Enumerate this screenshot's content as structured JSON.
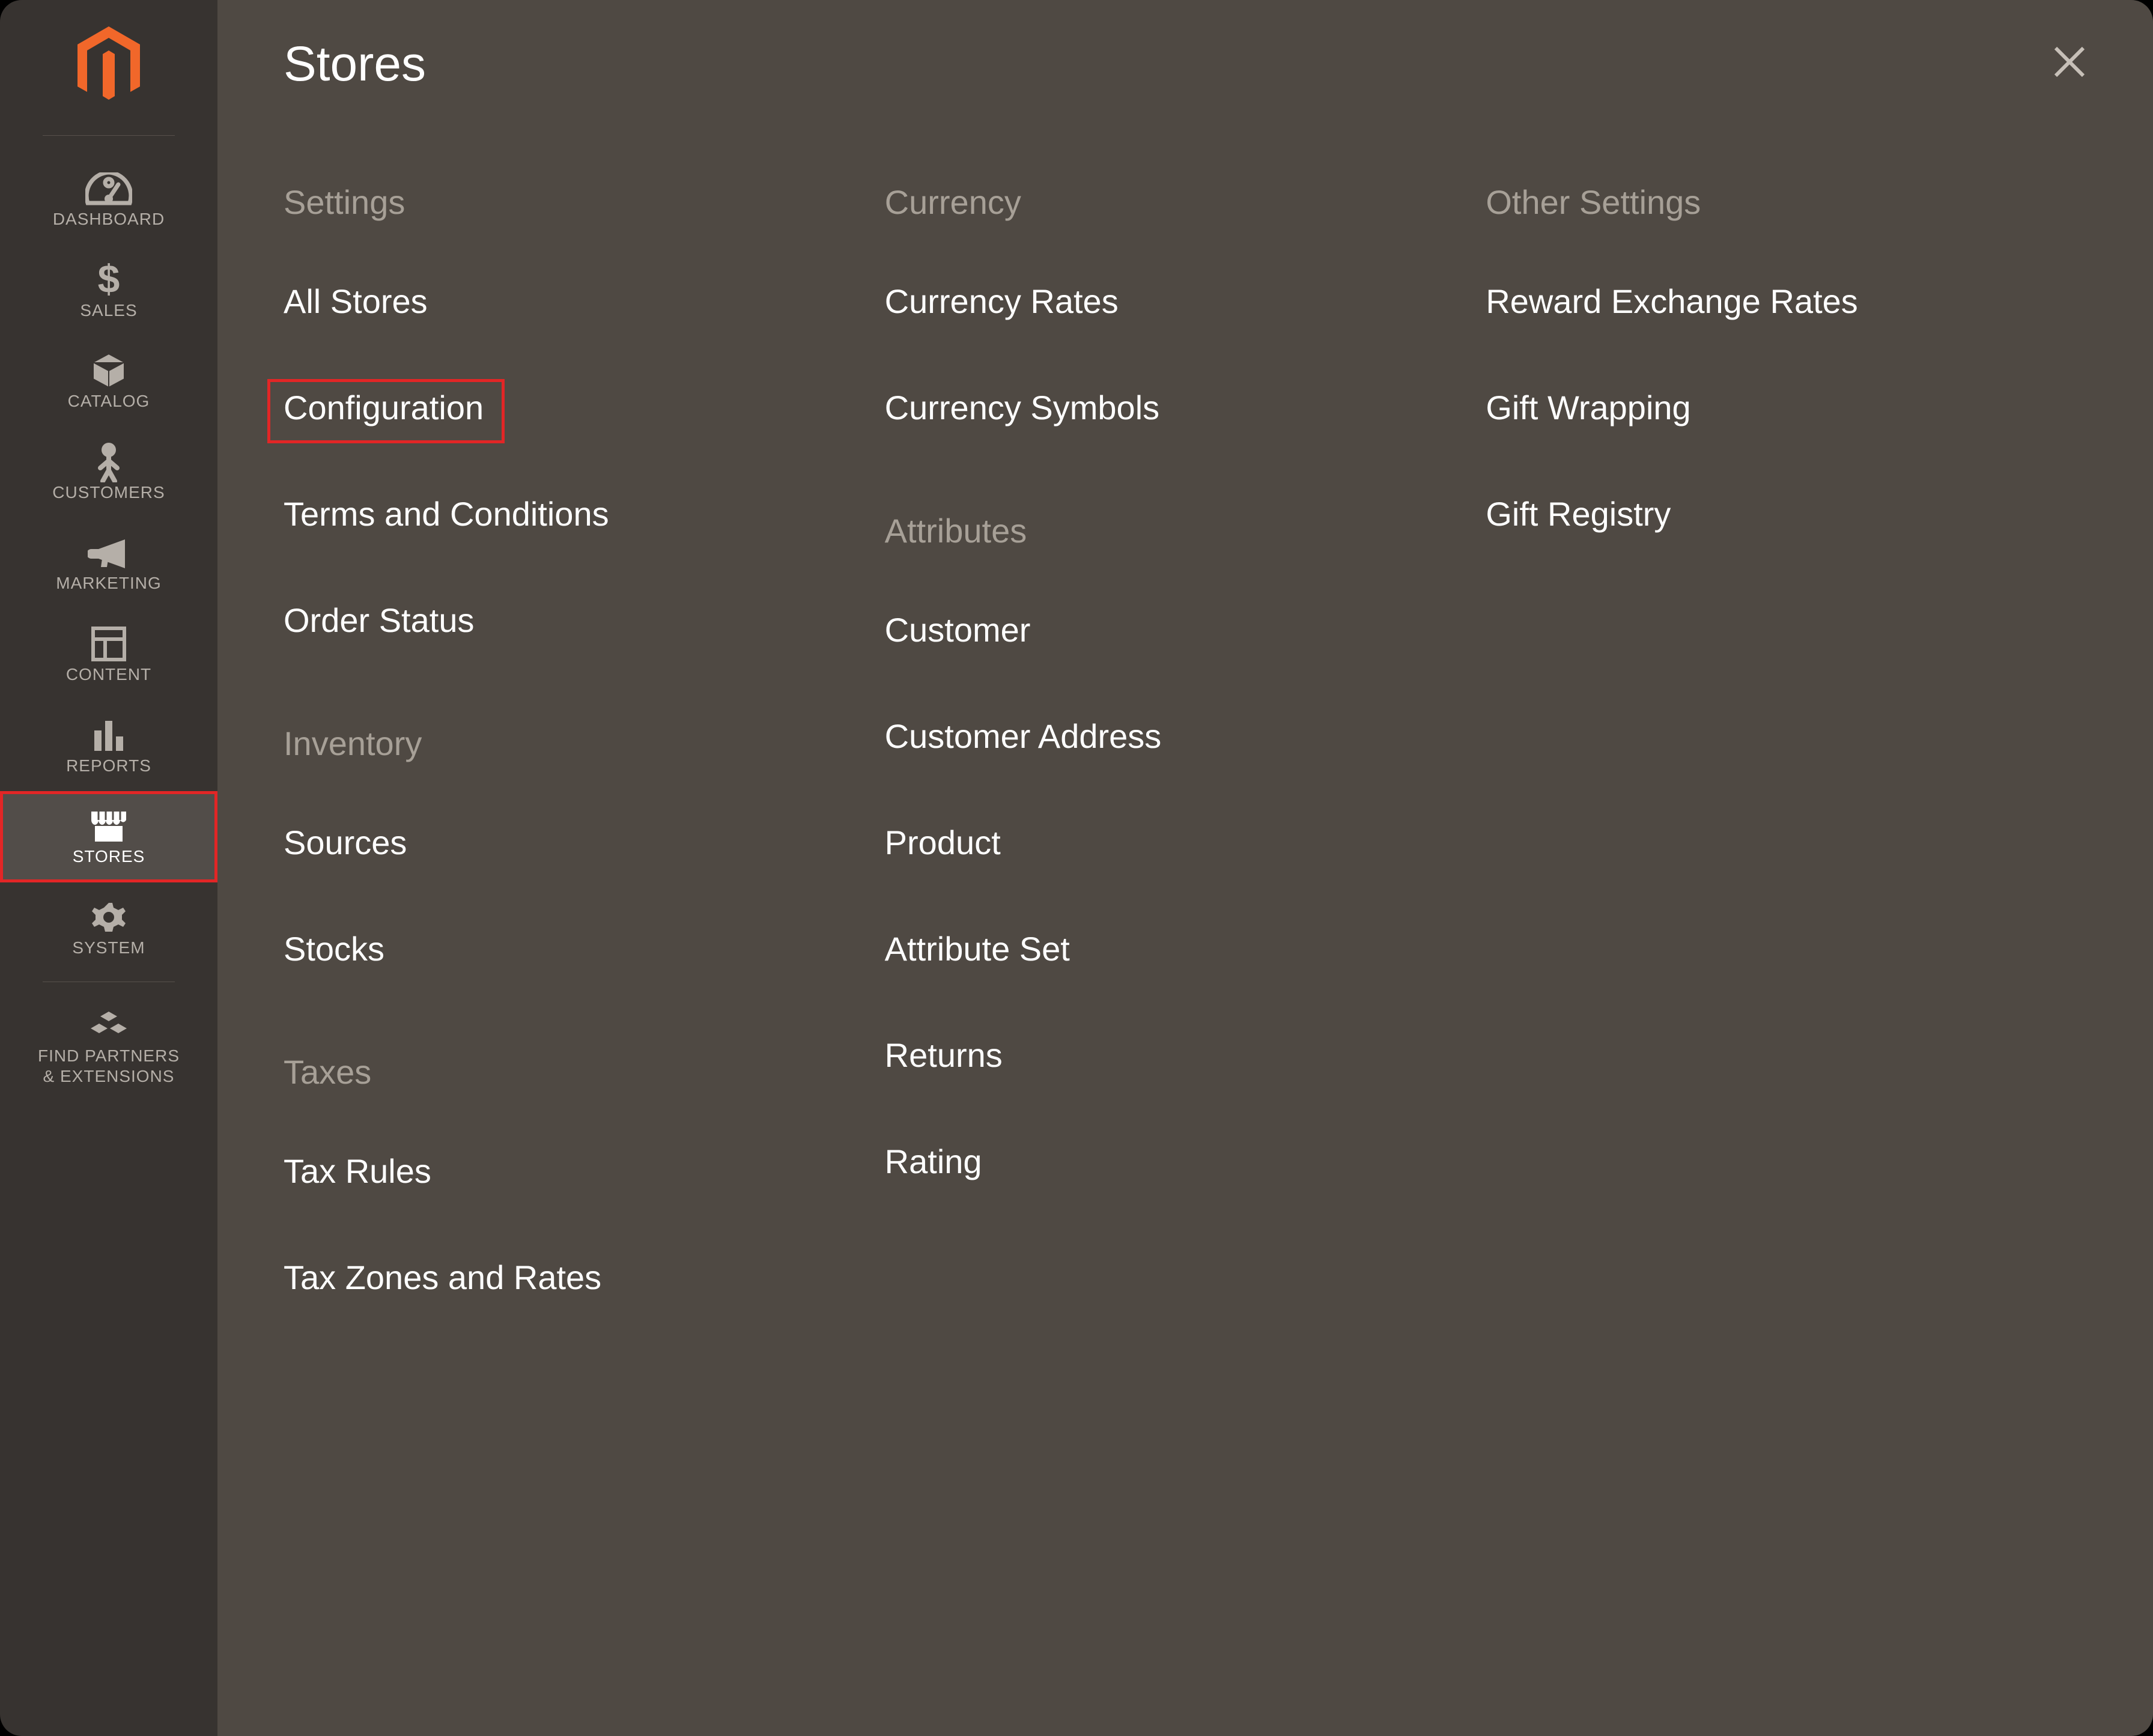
{
  "sidebar": {
    "items": [
      {
        "id": "dashboard",
        "label": "DASHBOARD",
        "active": false
      },
      {
        "id": "sales",
        "label": "SALES",
        "active": false
      },
      {
        "id": "catalog",
        "label": "CATALOG",
        "active": false
      },
      {
        "id": "customers",
        "label": "CUSTOMERS",
        "active": false
      },
      {
        "id": "marketing",
        "label": "MARKETING",
        "active": false
      },
      {
        "id": "content",
        "label": "CONTENT",
        "active": false
      },
      {
        "id": "reports",
        "label": "REPORTS",
        "active": false
      },
      {
        "id": "stores",
        "label": "STORES",
        "active": true
      },
      {
        "id": "system",
        "label": "SYSTEM",
        "active": false
      },
      {
        "id": "find-partners",
        "label": "FIND PARTNERS\n& EXTENSIONS",
        "active": false
      }
    ]
  },
  "panel": {
    "title": "Stores",
    "columns": [
      {
        "sections": [
          {
            "heading": "Settings",
            "items": [
              {
                "label": "All Stores",
                "highlighted": false
              },
              {
                "label": "Configuration",
                "highlighted": true
              },
              {
                "label": "Terms and Conditions",
                "highlighted": false
              },
              {
                "label": "Order Status",
                "highlighted": false
              }
            ]
          },
          {
            "heading": "Inventory",
            "items": [
              {
                "label": "Sources",
                "highlighted": false
              },
              {
                "label": "Stocks",
                "highlighted": false
              }
            ]
          },
          {
            "heading": "Taxes",
            "items": [
              {
                "label": "Tax Rules",
                "highlighted": false
              },
              {
                "label": "Tax Zones and Rates",
                "highlighted": false
              }
            ]
          }
        ]
      },
      {
        "sections": [
          {
            "heading": "Currency",
            "items": [
              {
                "label": "Currency Rates",
                "highlighted": false
              },
              {
                "label": "Currency Symbols",
                "highlighted": false
              }
            ]
          },
          {
            "heading": "Attributes",
            "items": [
              {
                "label": "Customer",
                "highlighted": false
              },
              {
                "label": "Customer Address",
                "highlighted": false
              },
              {
                "label": "Product",
                "highlighted": false
              },
              {
                "label": "Attribute Set",
                "highlighted": false
              },
              {
                "label": "Returns",
                "highlighted": false
              },
              {
                "label": "Rating",
                "highlighted": false
              }
            ]
          }
        ]
      },
      {
        "sections": [
          {
            "heading": "Other Settings",
            "items": [
              {
                "label": "Reward Exchange Rates",
                "highlighted": false
              },
              {
                "label": "Gift Wrapping",
                "highlighted": false
              },
              {
                "label": "Gift Registry",
                "highlighted": false
              }
            ]
          }
        ]
      }
    ]
  },
  "colors": {
    "accent": "#f1672a",
    "highlight": "#e22626"
  }
}
